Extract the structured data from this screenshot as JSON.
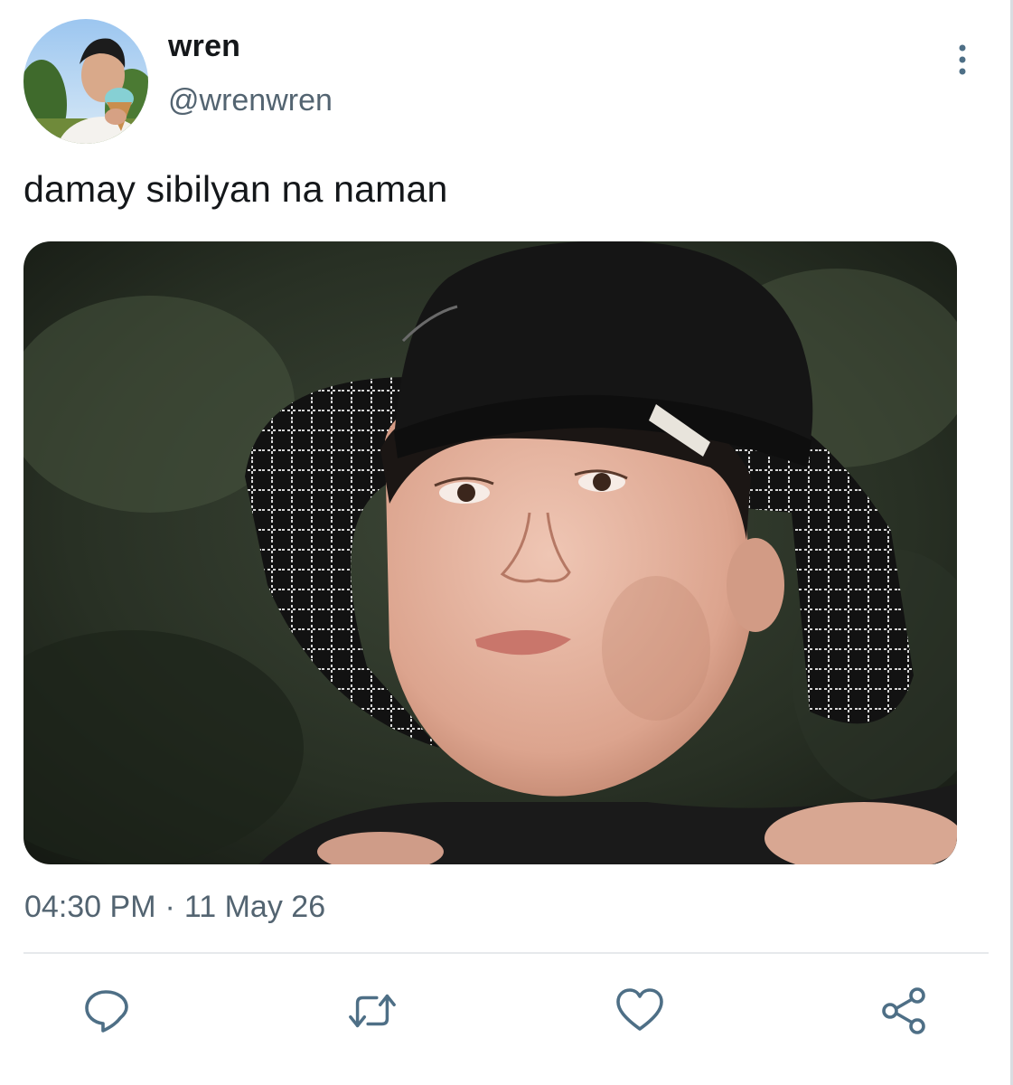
{
  "tweet": {
    "author": {
      "display_name": "wren",
      "handle": "@wrenwren",
      "avatar_icon": "profile-photo"
    },
    "text": "damay sibilyan na naman",
    "media_icon": "attached-photo",
    "time": "04:30 PM",
    "separator": "·",
    "date": "11 May 26"
  },
  "actions": [
    {
      "name": "reply",
      "icon": "speech-bubble-icon"
    },
    {
      "name": "retweet",
      "icon": "retweet-arrows-icon"
    },
    {
      "name": "like",
      "icon": "heart-icon"
    },
    {
      "name": "share",
      "icon": "share-nodes-icon"
    }
  ],
  "colors": {
    "text": "#14171a",
    "secondary_text": "#536471",
    "icon": "#4e6f86",
    "divider": "#e6e9ec"
  }
}
